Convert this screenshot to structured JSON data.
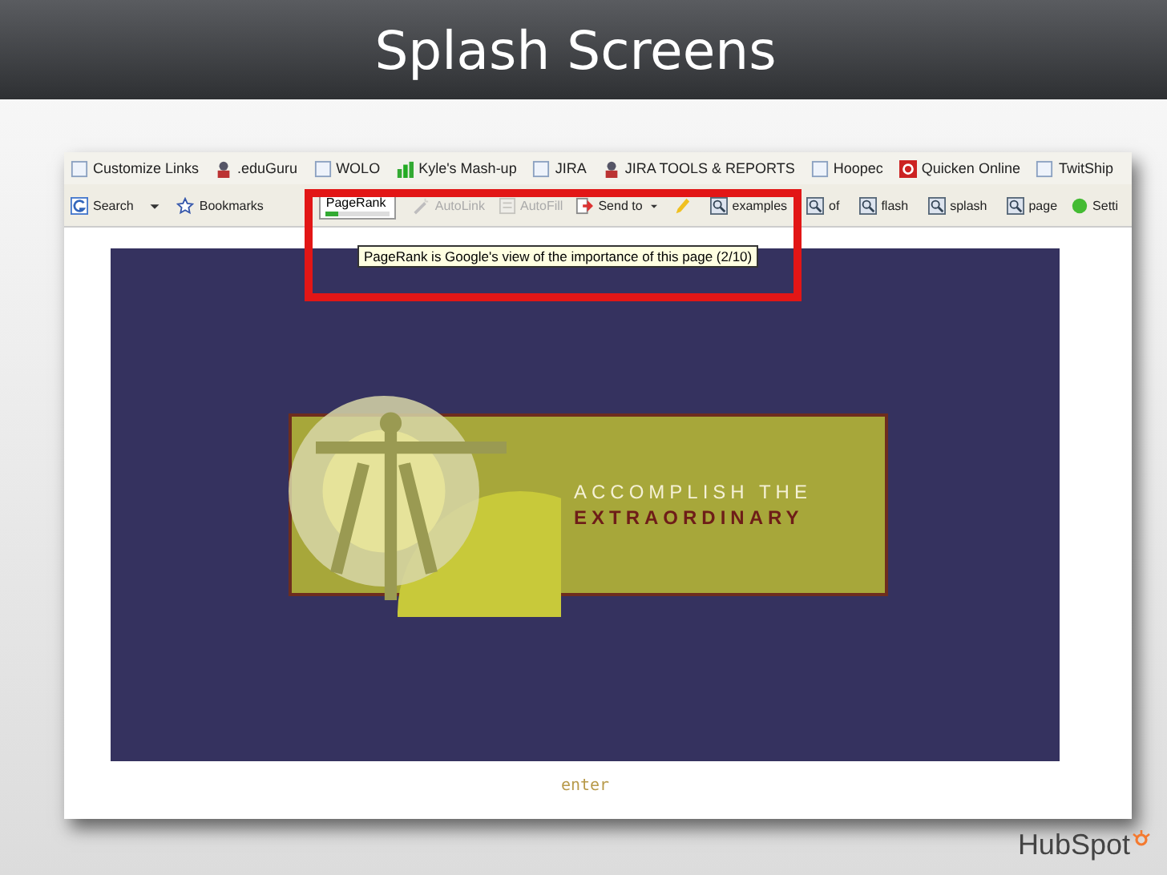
{
  "slide": {
    "title": "Splash Screens",
    "logo": "HubSpot"
  },
  "bookmarks": [
    {
      "label": "Customize Links",
      "kind": "page"
    },
    {
      "label": ".eduGuru",
      "kind": "user"
    },
    {
      "label": "WOLO",
      "kind": "page"
    },
    {
      "label": "Kyle's Mash-up",
      "kind": "chart"
    },
    {
      "label": "JIRA",
      "kind": "page"
    },
    {
      "label": "JIRA TOOLS & REPORTS",
      "kind": "user"
    },
    {
      "label": "Hoopec",
      "kind": "page"
    },
    {
      "label": "Quicken Online",
      "kind": "quicken"
    },
    {
      "label": "TwitShip",
      "kind": "page"
    }
  ],
  "toolbar": [
    {
      "label": "Search",
      "kind": "search",
      "disabled": false
    },
    {
      "kind": "dropdown"
    },
    {
      "label": "Bookmarks",
      "kind": "star",
      "disabled": false
    },
    {
      "label": "PageRank",
      "kind": "pagerank",
      "level": 0.2
    },
    {
      "label": "AutoLink",
      "kind": "wand",
      "disabled": true
    },
    {
      "label": "AutoFill",
      "kind": "form",
      "disabled": true
    },
    {
      "label": "Send to",
      "kind": "send",
      "disabled": false
    },
    {
      "kind": "highlighter"
    },
    {
      "label": "examples",
      "kind": "find",
      "disabled": false
    },
    {
      "label": "of",
      "kind": "find",
      "disabled": false
    },
    {
      "label": "flash",
      "kind": "find",
      "disabled": false
    },
    {
      "label": "splash",
      "kind": "find",
      "disabled": false
    },
    {
      "label": "page",
      "kind": "find",
      "disabled": false
    },
    {
      "label": "Setti",
      "kind": "settings",
      "disabled": false
    }
  ],
  "tooltip": "PageRank is Google's view of the importance of this page (2/10)",
  "splash": {
    "headline": "ACCOMPLISH THE",
    "highlight": "EXTRAORDINARY",
    "enter_link": "enter"
  }
}
